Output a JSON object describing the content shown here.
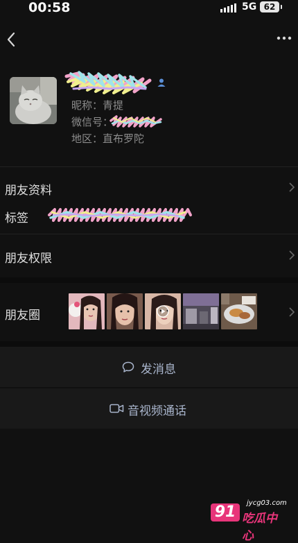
{
  "status_bar": {
    "time": "00:58",
    "network": "5G",
    "battery": "62"
  },
  "profile": {
    "nickname_label": "昵称：",
    "nickname_value": "青提",
    "wechat_id_label": "微信号：",
    "region_label": "地区：",
    "region_value": "直布罗陀"
  },
  "sections": {
    "friend_profile": "朋友资料",
    "tags": "标签",
    "friend_permissions": "朋友权限",
    "moments": "朋友圈"
  },
  "actions": {
    "send_message": "发消息",
    "video_call": "音视频通话"
  },
  "watermark": {
    "number": "91",
    "url": "jycg03.com",
    "name": "吃瓜中心"
  },
  "colors": {
    "background": "#111111",
    "action_text": "#a9b5cc",
    "watermark": "#e8357a"
  },
  "icons": [
    "back-icon",
    "more-icon",
    "person-icon",
    "chevron-right-icon",
    "chat-bubble-icon",
    "video-camera-icon",
    "play-icon"
  ]
}
